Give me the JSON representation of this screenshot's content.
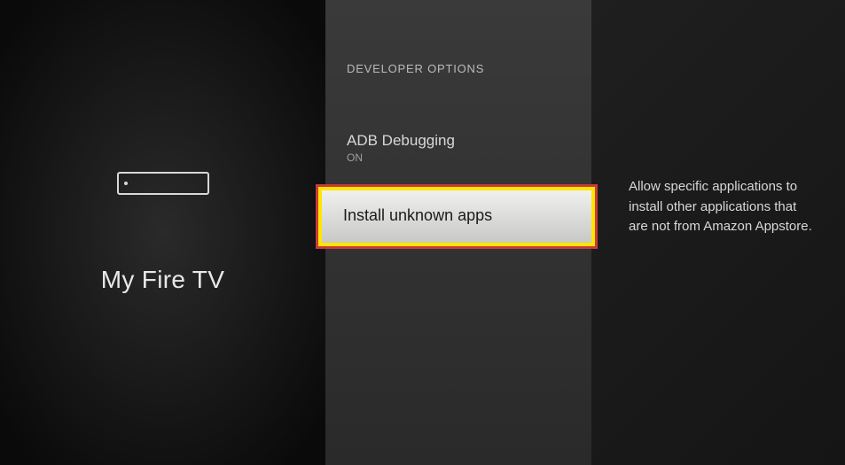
{
  "left": {
    "device_label": "My Fire TV"
  },
  "middle": {
    "section_header": "DEVELOPER OPTIONS",
    "items": [
      {
        "title": "ADB Debugging",
        "value": "ON"
      },
      {
        "title": "Install unknown apps"
      }
    ]
  },
  "right": {
    "description": "Allow specific applications to install other applications that are not from Amazon Appstore."
  }
}
